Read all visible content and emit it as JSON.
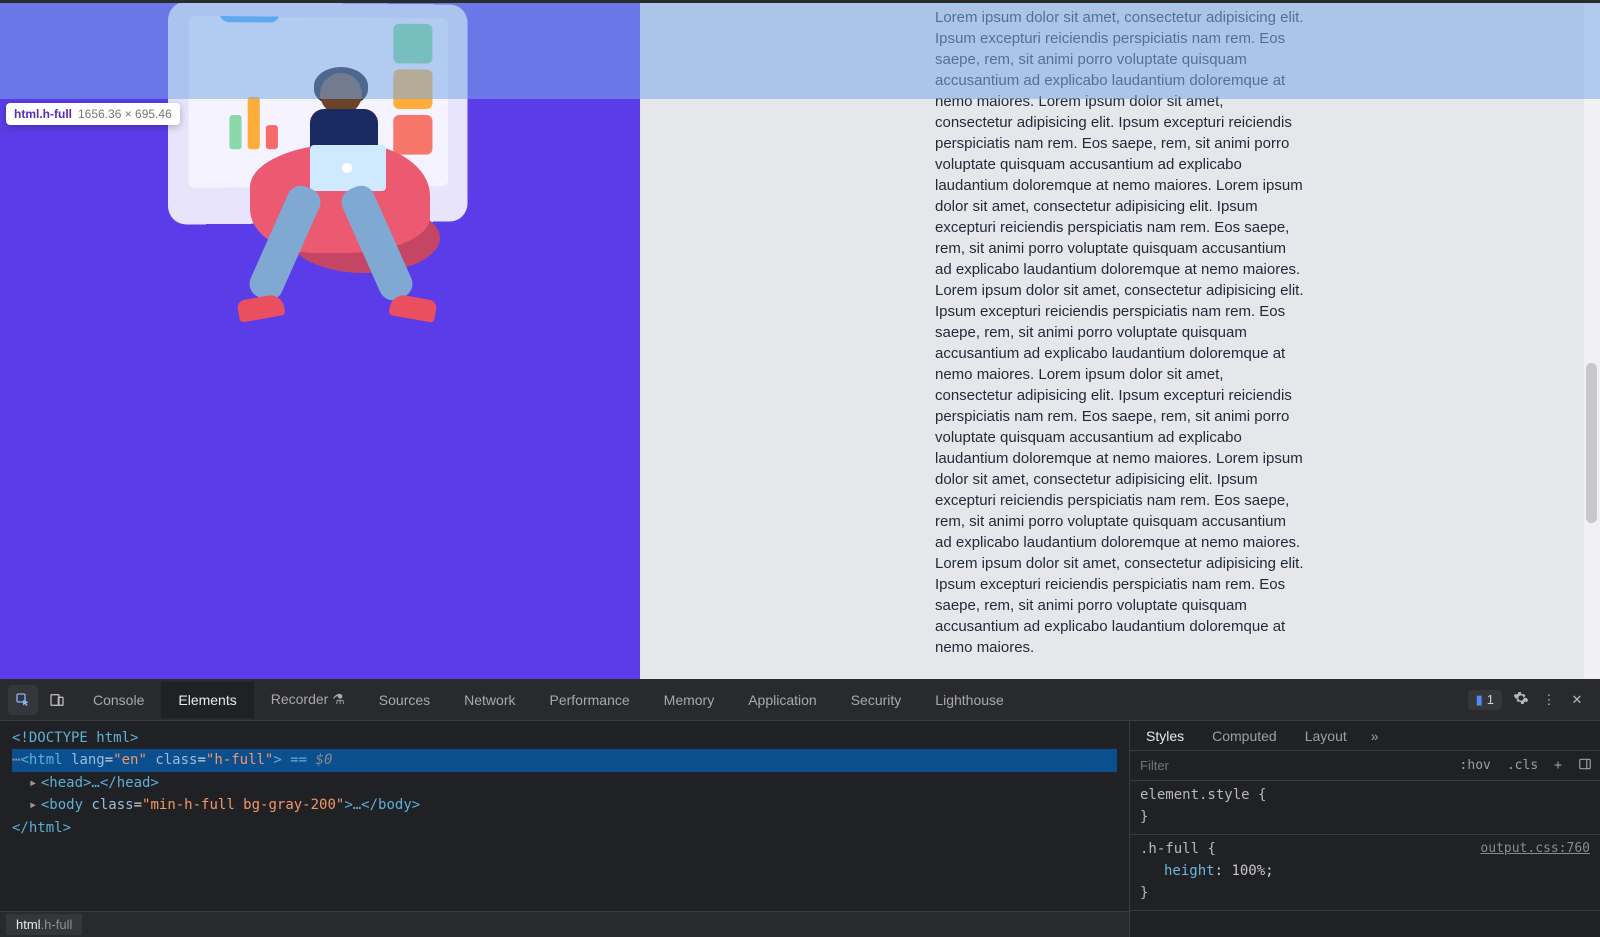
{
  "inspect_tooltip": {
    "selector": "html.h-full",
    "dimensions": "1656.36 × 695.46"
  },
  "page": {
    "lorem": "Lorem ipsum dolor sit amet, consectetur adipisicing elit. Ipsum excepturi reiciendis perspiciatis nam rem. Eos saepe, rem, sit animi porro voluptate quisquam accusantium ad explicabo laudantium doloremque at nemo maiores."
  },
  "devtools": {
    "tabs": [
      "Console",
      "Elements",
      "Recorder",
      "Sources",
      "Network",
      "Performance",
      "Memory",
      "Application",
      "Security",
      "Lighthouse"
    ],
    "active_tab": "Elements",
    "issue_count": "1",
    "dom": {
      "line1": "<!DOCTYPE html>",
      "line2_pre": "<html ",
      "line2_lang_attr": "lang",
      "line2_lang_val": "\"en\"",
      "line2_class_attr": "class",
      "line2_class_val": "\"h-full\"",
      "line2_post": "> == ",
      "line2_eq0": "$0",
      "line3": "<head>…</head>",
      "line4_pre": "<body ",
      "line4_class_attr": "class",
      "line4_class_val": "\"min-h-full bg-gray-200\"",
      "line4_post": ">…</body>",
      "line5": "</html>"
    },
    "breadcrumb": {
      "el": "html",
      "cls": ".h-full"
    },
    "styles": {
      "tabs": [
        "Styles",
        "Computed",
        "Layout"
      ],
      "active": "Styles",
      "filter_placeholder": "Filter",
      "btn_hov": ":hov",
      "btn_cls": ".cls",
      "rule1_selector": "element.style",
      "rule2_selector": ".h-full",
      "rule2_origin": "output.css:760",
      "rule2_prop": "height",
      "rule2_val": "100%"
    }
  }
}
